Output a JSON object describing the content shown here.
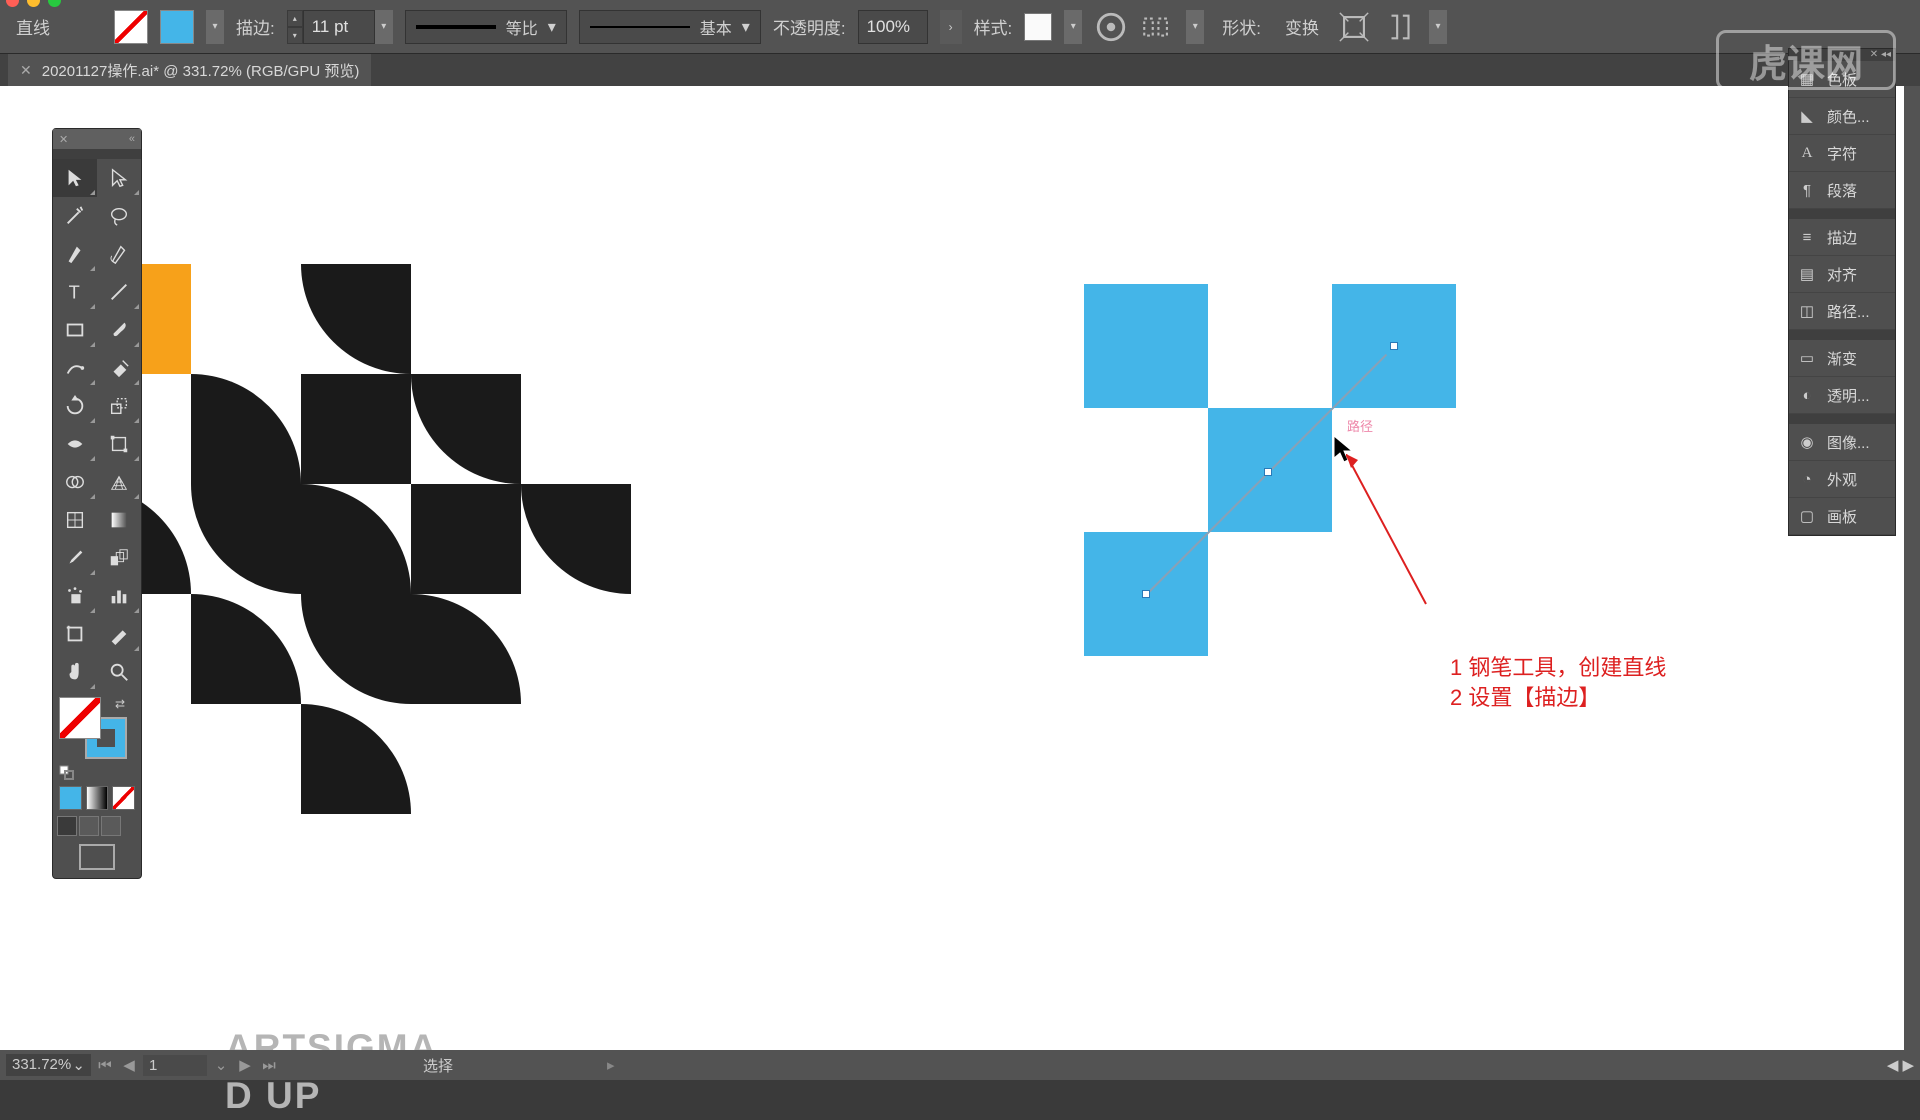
{
  "app": {
    "platform_buttons": [
      "close",
      "min",
      "max"
    ]
  },
  "control_bar": {
    "tool_label": "直线",
    "stroke_label": "描边:",
    "stroke_weight": "11 pt",
    "profile_label": "等比",
    "brush_label": "基本",
    "opacity_label": "不透明度:",
    "opacity_value": "100%",
    "style_label": "样式:",
    "shape_label": "形状:",
    "transform_label": "变换"
  },
  "document": {
    "tab_title": "20201127操作.ai* @ 331.72% (RGB/GPU 预览)"
  },
  "right_panels": [
    {
      "icon": "swatches",
      "label": "色板"
    },
    {
      "icon": "color",
      "label": "颜色..."
    },
    {
      "icon": "character",
      "label": "字符"
    },
    {
      "icon": "paragraph",
      "label": "段落"
    },
    {
      "sep": true
    },
    {
      "icon": "stroke",
      "label": "描边"
    },
    {
      "icon": "align",
      "label": "对齐"
    },
    {
      "icon": "pathfinder",
      "label": "路径..."
    },
    {
      "sep": true
    },
    {
      "icon": "gradient",
      "label": "渐变"
    },
    {
      "icon": "transparency",
      "label": "透明..."
    },
    {
      "sep": true
    },
    {
      "icon": "image",
      "label": "图像..."
    },
    {
      "icon": "appearance",
      "label": "外观"
    },
    {
      "icon": "artboards",
      "label": "画板"
    }
  ],
  "canvas": {
    "pink_hint_label": "路径",
    "notes": [
      "1 钢笔工具，创建直线",
      "2 设置【描边】"
    ],
    "artsigma_line1": "ARTSIGMA",
    "artsigma_line2": "D UP"
  },
  "status_bar": {
    "zoom": "331.72%",
    "page": "1",
    "selection_label": "选择"
  },
  "watermark": "虎课网",
  "colors": {
    "blue": "#44b5e8",
    "orange": "#f7a11a",
    "note_red": "#dd2020"
  }
}
